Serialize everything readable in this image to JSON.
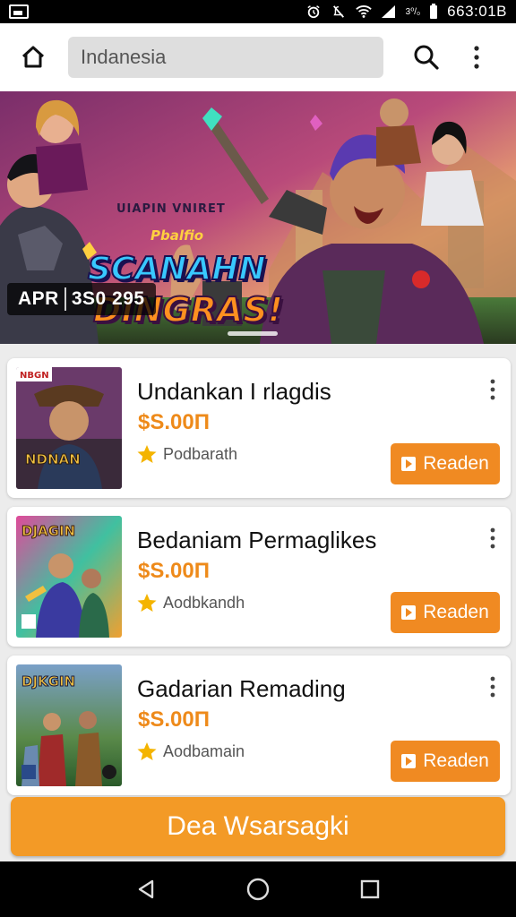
{
  "status_bar": {
    "time": "663:01B",
    "battery_text": "3⁰/₀"
  },
  "app_bar": {
    "search_value": "Indanesia"
  },
  "banner": {
    "subtitle": "UIAPIN VNIRET",
    "tag": "Pbalfio",
    "title_line1": "SCANAHN",
    "title_line2": "DINGRAS!",
    "date_prefix": "APR",
    "date_value": "3S0 295"
  },
  "cards": [
    {
      "title": "Undankan I rlagdis",
      "price": "$S.00П",
      "rating_label": "Podbarath",
      "button_label": "Readen",
      "thumb_label": "NDNAN",
      "thumb_badge": "NBGN"
    },
    {
      "title": "Bedaniam Permaglikes",
      "price": "$S.00П",
      "rating_label": "Aodbkandh",
      "button_label": "Readen",
      "thumb_label": "DJAGIN"
    },
    {
      "title": "Gadarian Remading",
      "price": "$S.00П",
      "rating_label": "Aodbamain",
      "button_label": "Readen",
      "thumb_label": "DJKGIN"
    }
  ],
  "bottom_cta": "Dea Wsarsagki",
  "colors": {
    "accent": "#f08a22",
    "price": "#ee8a1a",
    "star": "#f4b400"
  },
  "icons": [
    "home-icon",
    "search-icon",
    "more-vert-icon",
    "star-icon",
    "play-icon",
    "back-icon",
    "circle-home-icon",
    "recents-icon"
  ]
}
